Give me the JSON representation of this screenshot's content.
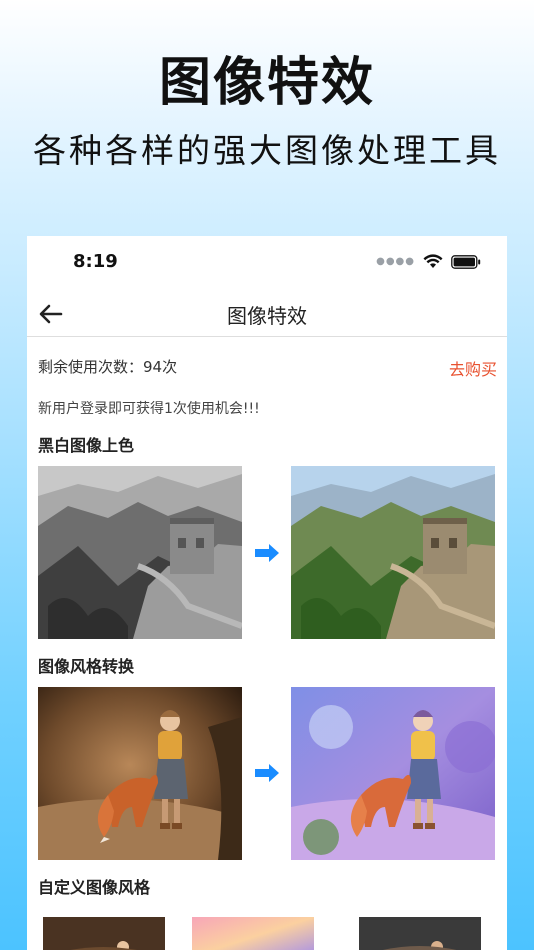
{
  "promo": {
    "title": "图像特效",
    "subtitle": "各种各样的强大图像处理工具"
  },
  "status_bar": {
    "time": "8:19"
  },
  "nav": {
    "title": "图像特效"
  },
  "quota": {
    "label": "剩余使用次数：",
    "value": "94次",
    "buy_label": "去购买"
  },
  "tip": "新用户登录即可获得1次使用机会!!!",
  "sections": [
    {
      "title": "黑白图像上色"
    },
    {
      "title": "图像风格转换"
    },
    {
      "title": "自定义图像风格"
    }
  ],
  "colors": {
    "accent": "#e8512f",
    "arrow": "#1a8cff"
  }
}
